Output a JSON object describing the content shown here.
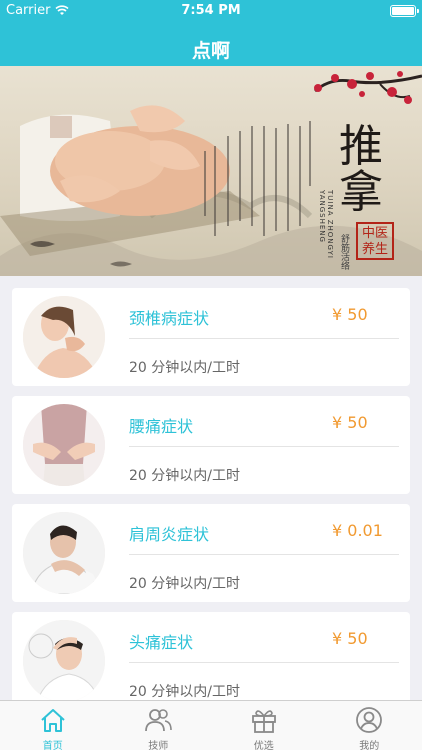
{
  "status_bar": {
    "carrier": "Carrier",
    "time": "7:54 PM"
  },
  "nav": {
    "title": "点啊"
  },
  "banner": {
    "title": "推拿",
    "subtitle": "舒筋活络",
    "pinyin": "TUINA ZHONGYI YANGSHENG",
    "seal": "中医养生"
  },
  "services": [
    {
      "name": "颈椎病症状",
      "price": "¥ 50",
      "duration": "20 分钟以内/工时",
      "image": "neck-pain"
    },
    {
      "name": "腰痛症状",
      "price": "¥ 50",
      "duration": "20 分钟以内/工时",
      "image": "back-pain"
    },
    {
      "name": "肩周炎症状",
      "price": "¥ 0.01",
      "duration": "20 分钟以内/工时",
      "image": "shoulder-pain"
    },
    {
      "name": "头痛症状",
      "price": "¥ 50",
      "duration": "20 分钟以内/工时",
      "image": "headache"
    }
  ],
  "tabbar": {
    "items": [
      {
        "label": "首页",
        "icon": "home-icon",
        "active": true
      },
      {
        "label": "技师",
        "icon": "people-icon",
        "active": false
      },
      {
        "label": "优选",
        "icon": "gift-icon",
        "active": false
      },
      {
        "label": "我的",
        "icon": "user-icon",
        "active": false
      }
    ]
  },
  "colors": {
    "accent": "#2ec2d7",
    "price": "#f19a31"
  }
}
